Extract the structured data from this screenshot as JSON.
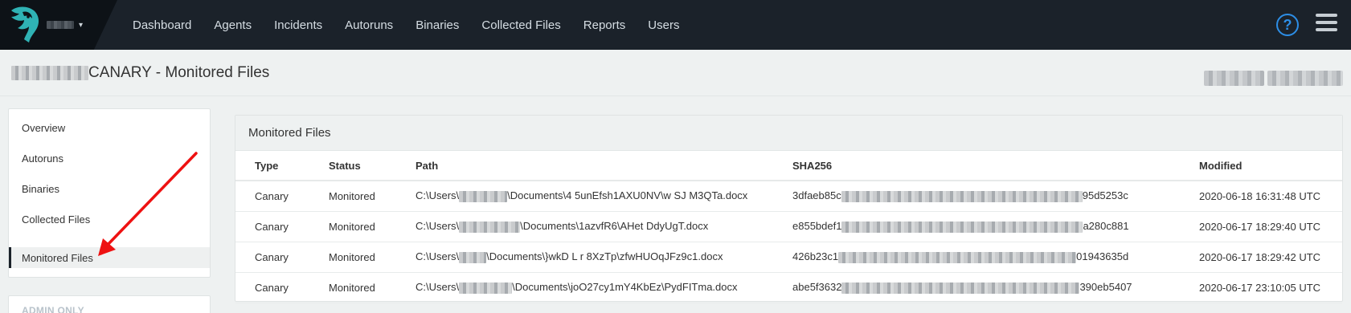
{
  "nav": {
    "links": [
      "Dashboard",
      "Agents",
      "Incidents",
      "Autoruns",
      "Binaries",
      "Collected Files",
      "Reports",
      "Users"
    ],
    "help_glyph": "?",
    "org_caret": "▾"
  },
  "header": {
    "title": "CANARY - Monitored Files"
  },
  "sidebar": {
    "items": [
      "Overview",
      "Autoruns",
      "Binaries",
      "Collected Files",
      "Monitored Files"
    ],
    "active": "Monitored Files",
    "admin_label": "ADMIN ONLY"
  },
  "panel": {
    "title": "Monitored Files",
    "columns": [
      "Type",
      "Status",
      "Path",
      "SHA256",
      "Modified"
    ],
    "rows": [
      {
        "type": "Canary",
        "status": "Monitored",
        "path_prefix": "C:\\Users\\",
        "path_suffix": "\\Documents\\4 5unEfsh1AXU0NV\\w SJ M3QTa.docx",
        "sha_prefix": "3dfaeb85c",
        "sha_suffix": "95d5253c",
        "modified": "2020-06-18 16:31:48 UTC"
      },
      {
        "type": "Canary",
        "status": "Monitored",
        "path_prefix": "C:\\Users\\",
        "path_suffix": "\\Documents\\1azvfR6\\AHet DdyUgT.docx",
        "sha_prefix": "e855bdef1",
        "sha_suffix": "a280c881",
        "modified": "2020-06-17 18:29:40 UTC"
      },
      {
        "type": "Canary",
        "status": "Monitored",
        "path_prefix": "C:\\Users\\",
        "path_suffix": "\\Documents\\}wkD L r 8XzTp\\zfwHUOqJFz9c1.docx",
        "sha_prefix": "426b23c1",
        "sha_suffix": "01943635d",
        "modified": "2020-06-17 18:29:42 UTC"
      },
      {
        "type": "Canary",
        "status": "Monitored",
        "path_prefix": "C:\\Users\\",
        "path_suffix": "\\Documents\\joO27cy1mY4KbEz\\PydFITma.docx",
        "sha_prefix": "abe5f3632",
        "sha_suffix": "390eb5407",
        "modified": "2020-06-17 23:10:05 UTC"
      }
    ]
  },
  "colors": {
    "navbar_bg": "#1b222a",
    "brand_teal": "#2fb2b4",
    "help_blue": "#2d8ee6",
    "annotation_red": "#ee1111"
  }
}
